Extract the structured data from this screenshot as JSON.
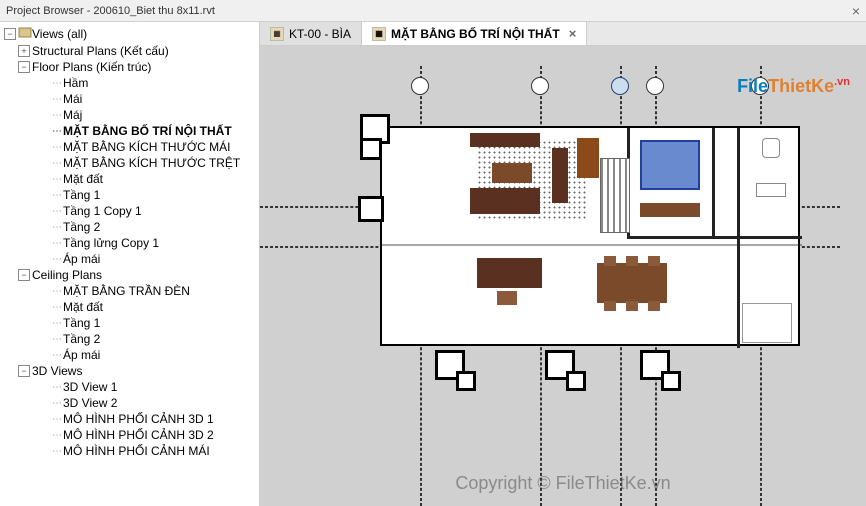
{
  "window": {
    "title": "Project Browser - 200610_Biet thu 8x11.rvt"
  },
  "tabs": [
    {
      "label": "KT-00 - BÌA",
      "active": false
    },
    {
      "label": "MẶT BẰNG BỐ TRÍ NỘI THẤT",
      "active": true
    }
  ],
  "tree": {
    "root": "Views (all)",
    "groups": [
      {
        "label": "Structural Plans (Kết cấu)",
        "expanded": false,
        "children": []
      },
      {
        "label": "Floor Plans (Kiến trúc)",
        "expanded": true,
        "children": [
          "Hầm",
          "Mái",
          "Máj",
          "MẶT BẰNG BỐ TRÍ NỘI THẤT",
          "MẶT BẰNG KÍCH THƯỚC MÁI",
          "MẶT BẰNG KÍCH THƯỚC TRỆT",
          "Mặt đất",
          "Tầng 1",
          "Tầng 1 Copy 1",
          "Tầng 2",
          "Tầng lửng Copy 1",
          "Áp mái"
        ],
        "selected": "MẶT BẰNG BỐ TRÍ NỘI THẤT"
      },
      {
        "label": "Ceiling Plans",
        "expanded": true,
        "children": [
          "MẶT BẰNG TRẦN ĐÈN",
          "Mặt đất",
          "Tầng 1",
          "Tầng 2",
          "Áp mái"
        ]
      },
      {
        "label": "3D Views",
        "expanded": true,
        "children": [
          "3D View 1",
          "3D View 2",
          "MÔ HÌNH PHỐI CẢNH 3D 1",
          "MÔ HÌNH PHỐI CẢNH 3D 2",
          "MÔ HÌNH PHỐI CẢNH MÁI"
        ]
      }
    ]
  },
  "watermark": {
    "logo_part1": "File",
    "logo_part2": "ThietKe",
    "logo_suffix": ".vn",
    "copyright": "Copyright © FileThietKe.vn"
  }
}
